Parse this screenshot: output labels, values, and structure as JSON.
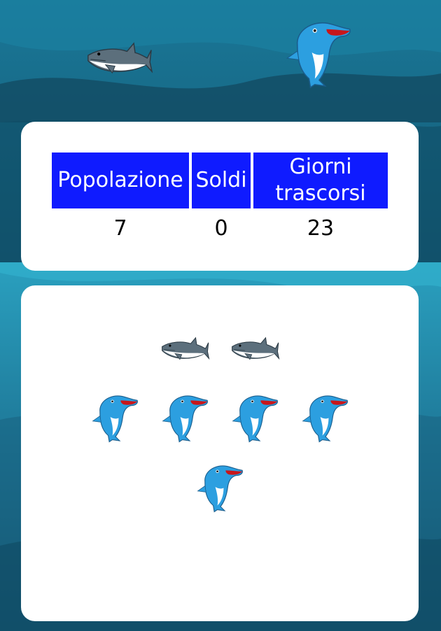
{
  "stats": {
    "headers": [
      "Popolazione",
      "Soldi",
      "Giorni trascorsi"
    ],
    "header_giorni_line1": "Giorni",
    "header_giorni_line2": "trascorsi",
    "values": {
      "popolazione": "7",
      "soldi": "0",
      "giorni": "23"
    }
  },
  "population": {
    "sharks": 2,
    "dolphins": 5
  },
  "colors": {
    "header_bg": "#0f1bff",
    "card_bg": "#ffffff",
    "ocean_top": "#1b4f66",
    "ocean_bottom": "#2a9fbd"
  },
  "icons": [
    "shark-icon",
    "dolphin-icon"
  ]
}
